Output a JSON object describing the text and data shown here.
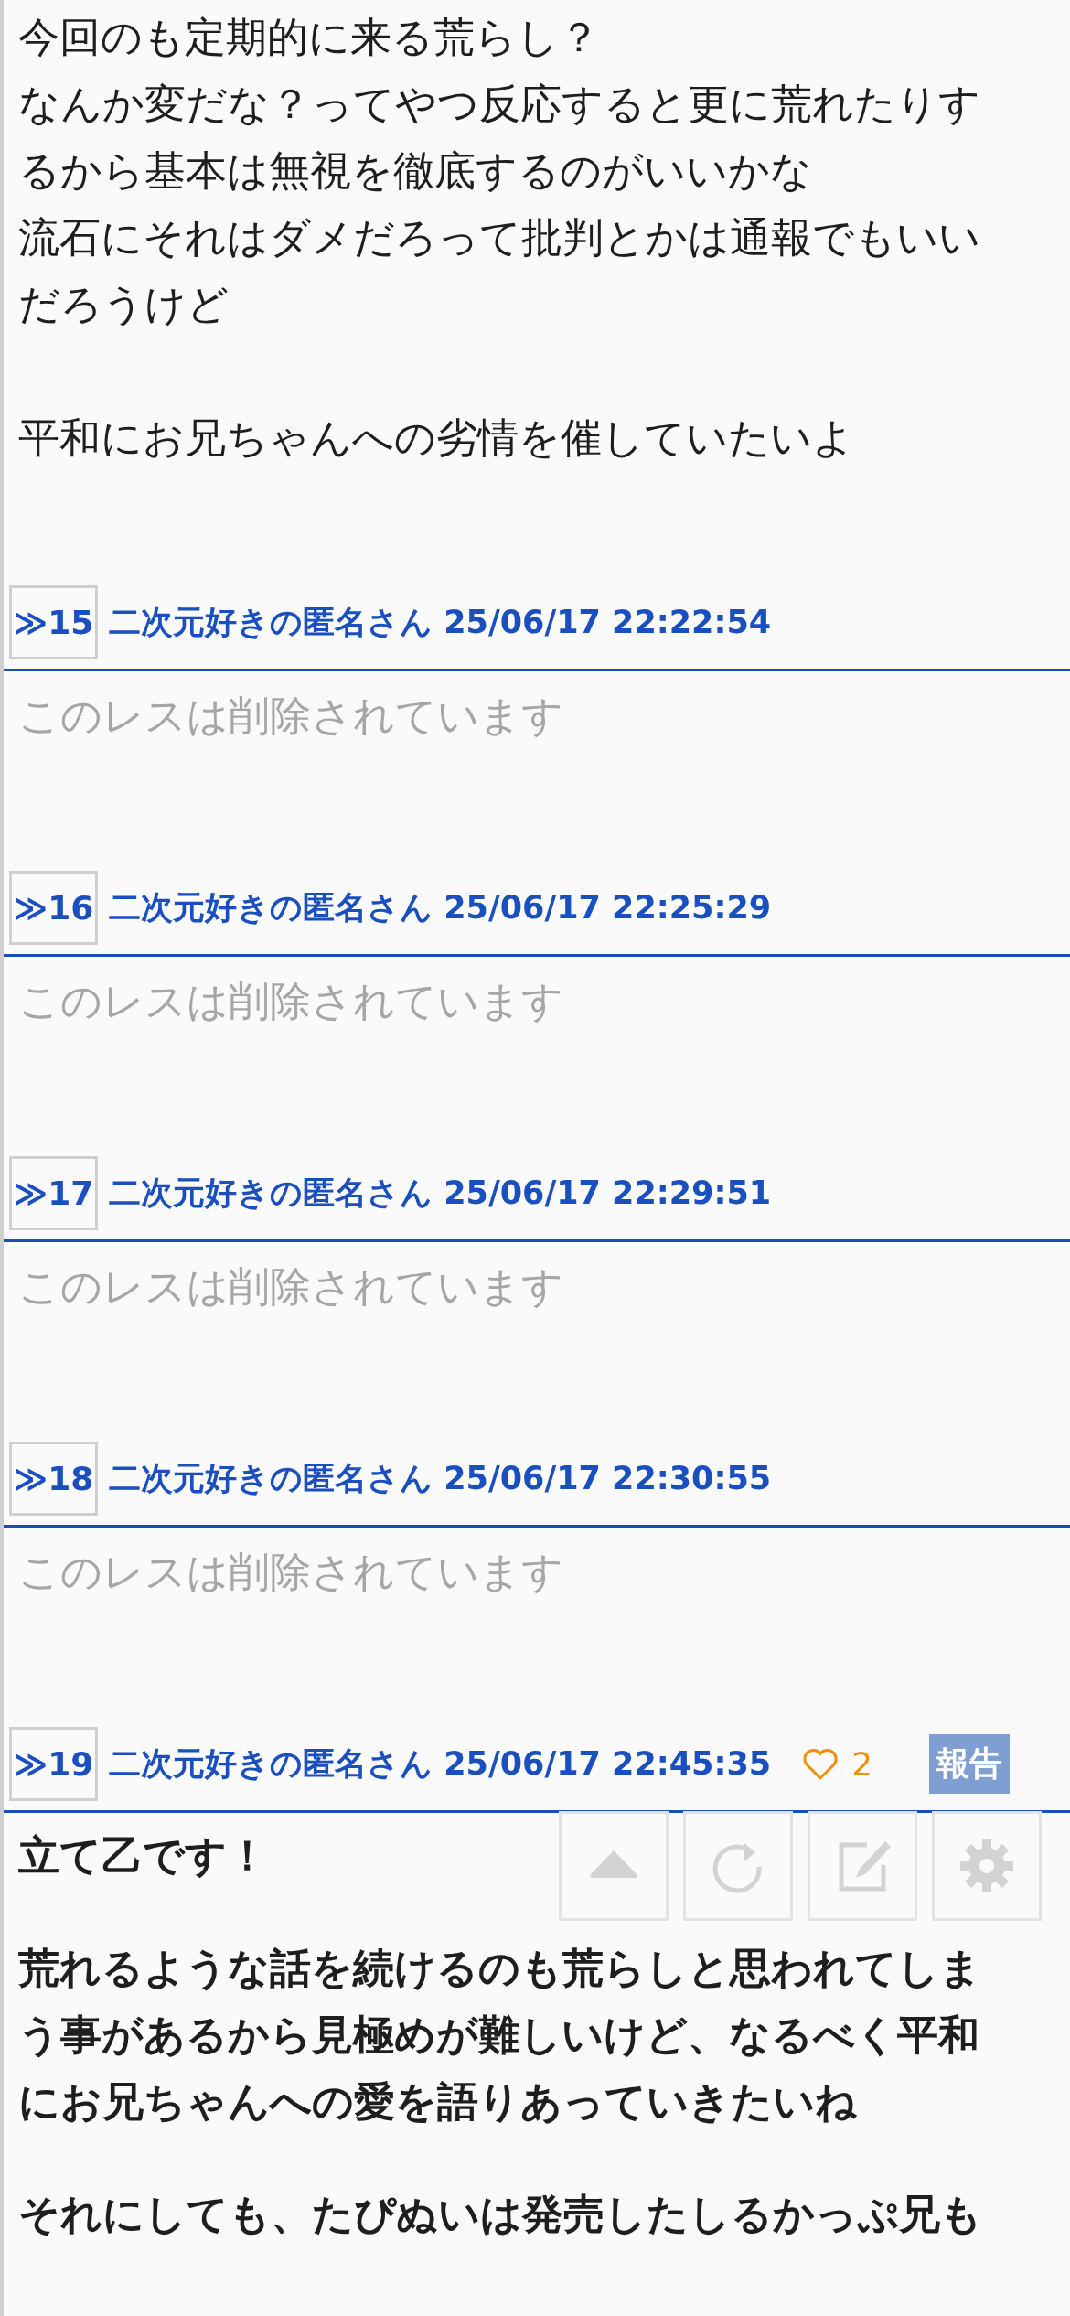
{
  "top_post": {
    "paragraphs": [
      [
        "今回のも定期的に来る荒らし？",
        "なんか変だな？ってやつ反応すると更に荒れたりす",
        "るから基本は無視を徹底するのがいいかな",
        "流石にそれはダメだろって批判とかは通報でもいい",
        "だろうけど"
      ],
      [
        "平和にお兄ちゃんへの劣情を催していたいよ"
      ]
    ]
  },
  "posts": [
    {
      "marker": "≫",
      "number": "15",
      "author": "二次元好きの匿名さん",
      "timestamp": "25/06/17 22:22:54",
      "deleted": true,
      "paragraphs": [
        [
          "このレスは削除されています"
        ]
      ]
    },
    {
      "marker": "≫",
      "number": "16",
      "author": "二次元好きの匿名さん",
      "timestamp": "25/06/17 22:25:29",
      "deleted": true,
      "paragraphs": [
        [
          "このレスは削除されています"
        ]
      ]
    },
    {
      "marker": "≫",
      "number": "17",
      "author": "二次元好きの匿名さん",
      "timestamp": "25/06/17 22:29:51",
      "deleted": true,
      "paragraphs": [
        [
          "このレスは削除されています"
        ]
      ]
    },
    {
      "marker": "≫",
      "number": "18",
      "author": "二次元好きの匿名さん",
      "timestamp": "25/06/17 22:30:55",
      "deleted": true,
      "paragraphs": [
        [
          "このレスは削除されています"
        ]
      ]
    },
    {
      "marker": "≫",
      "number": "19",
      "author": "二次元好きの匿名さん",
      "timestamp": "25/06/17 22:45:35",
      "deleted": false,
      "likes": "2",
      "report": "報告",
      "paragraphs": [
        [
          "立て乙です！"
        ],
        [
          "荒れるような話を続けるのも荒らしと思われてしま",
          "う事があるから見極めが難しいけど、なるべく平和",
          "にお兄ちゃんへの愛を語りあっていきたいね"
        ],
        [
          "それにしても、たぴぬいは発売したしるかっぷ兄も"
        ]
      ]
    }
  ],
  "toolbar": [
    {
      "kind": "up"
    },
    {
      "kind": "reload"
    },
    {
      "kind": "edit"
    },
    {
      "kind": "settings"
    }
  ]
}
